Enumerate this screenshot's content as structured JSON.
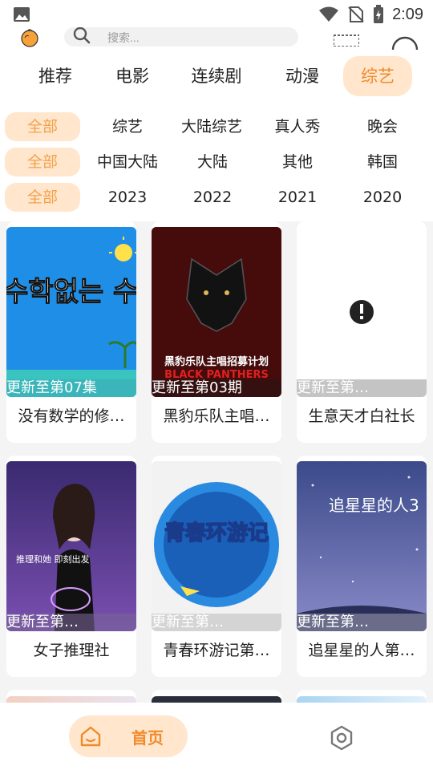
{
  "status_bar": {
    "time": "2:09"
  },
  "search": {
    "placeholder": "搜索..."
  },
  "tabs": [
    {
      "label": "推荐",
      "active": false
    },
    {
      "label": "电影",
      "active": false
    },
    {
      "label": "连续剧",
      "active": false
    },
    {
      "label": "动漫",
      "active": false
    },
    {
      "label": "综艺",
      "active": true
    }
  ],
  "filters": {
    "genre": {
      "selected": "全部",
      "options": [
        "综艺",
        "大陆综艺",
        "真人秀",
        "晚会"
      ]
    },
    "region": {
      "selected": "全部",
      "options": [
        "中国大陆",
        "大陆",
        "其他",
        "韩国"
      ]
    },
    "year": {
      "selected": "全部",
      "options": [
        "2023",
        "2022",
        "2021",
        "2020"
      ]
    }
  },
  "cards": [
    {
      "title": "没有数学的修…",
      "badge": "更新至第07集",
      "poster_text": "수학없는 수학여행",
      "accent": "#1e90e0"
    },
    {
      "title": "黑豹乐队主唱…",
      "badge": "更新至第03期",
      "poster_text": "黑豹乐队主唱招募计划",
      "poster_sub": "BLACK PANTHERS",
      "accent": "#1a1a1a"
    },
    {
      "title": "生意天才白社长",
      "badge": "更新至第…",
      "accent": "#ffffff"
    },
    {
      "title": "女子推理社",
      "badge": "更新至第…",
      "poster_text": "推理和她 即刻出发",
      "accent": "#4a3a7a"
    },
    {
      "title": "青春环游记第…",
      "badge": "更新至第…",
      "poster_text": "青春环游记",
      "accent": "#2a8ae0"
    },
    {
      "title": "追星星的人第…",
      "badge": "更新至第…",
      "poster_text": "追星星的人3",
      "accent": "#5a6aa8"
    }
  ],
  "bottom_nav": {
    "home_label": "首页"
  },
  "colors": {
    "accent": "#f08b2b",
    "accent_bg": "#ffe6cc"
  }
}
